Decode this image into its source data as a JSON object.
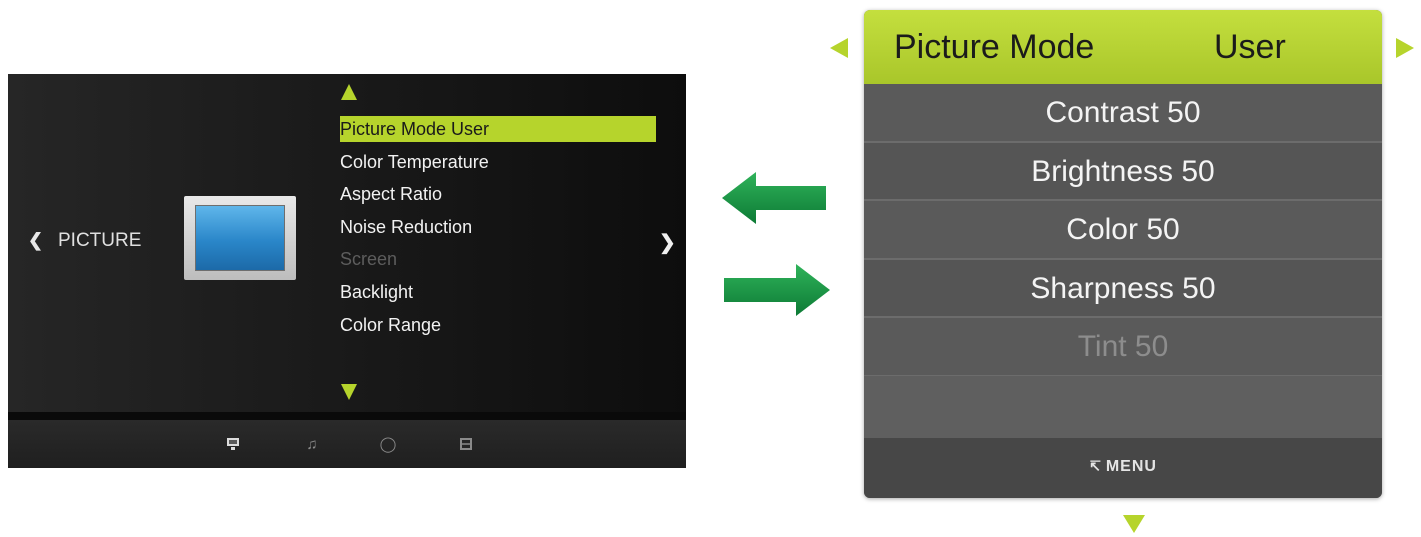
{
  "tv_menu": {
    "category": "PICTURE",
    "items": [
      {
        "label": "Picture Mode User",
        "state": "selected"
      },
      {
        "label": "Color Temperature",
        "state": "normal"
      },
      {
        "label": "Aspect Ratio",
        "state": "normal"
      },
      {
        "label": "Noise Reduction",
        "state": "normal"
      },
      {
        "label": "Screen",
        "state": "disabled"
      },
      {
        "label": "Backlight",
        "state": "normal"
      },
      {
        "label": "Color Range",
        "state": "normal"
      }
    ],
    "footer_icons": [
      "picture-icon",
      "music-icon",
      "settings-icon",
      "grid-icon"
    ]
  },
  "picture_mode_menu": {
    "title": "Picture Mode",
    "value": "User",
    "items": [
      {
        "label": "Contrast 50",
        "state": "normal"
      },
      {
        "label": "Brightness 50",
        "state": "normal"
      },
      {
        "label": "Color 50",
        "state": "normal"
      },
      {
        "label": "Sharpness 50",
        "state": "normal"
      },
      {
        "label": "Tint 50",
        "state": "disabled"
      }
    ],
    "footer_label": "MENU"
  },
  "colors": {
    "accent": "#b6d42c",
    "arrow_green": "#149a45"
  }
}
